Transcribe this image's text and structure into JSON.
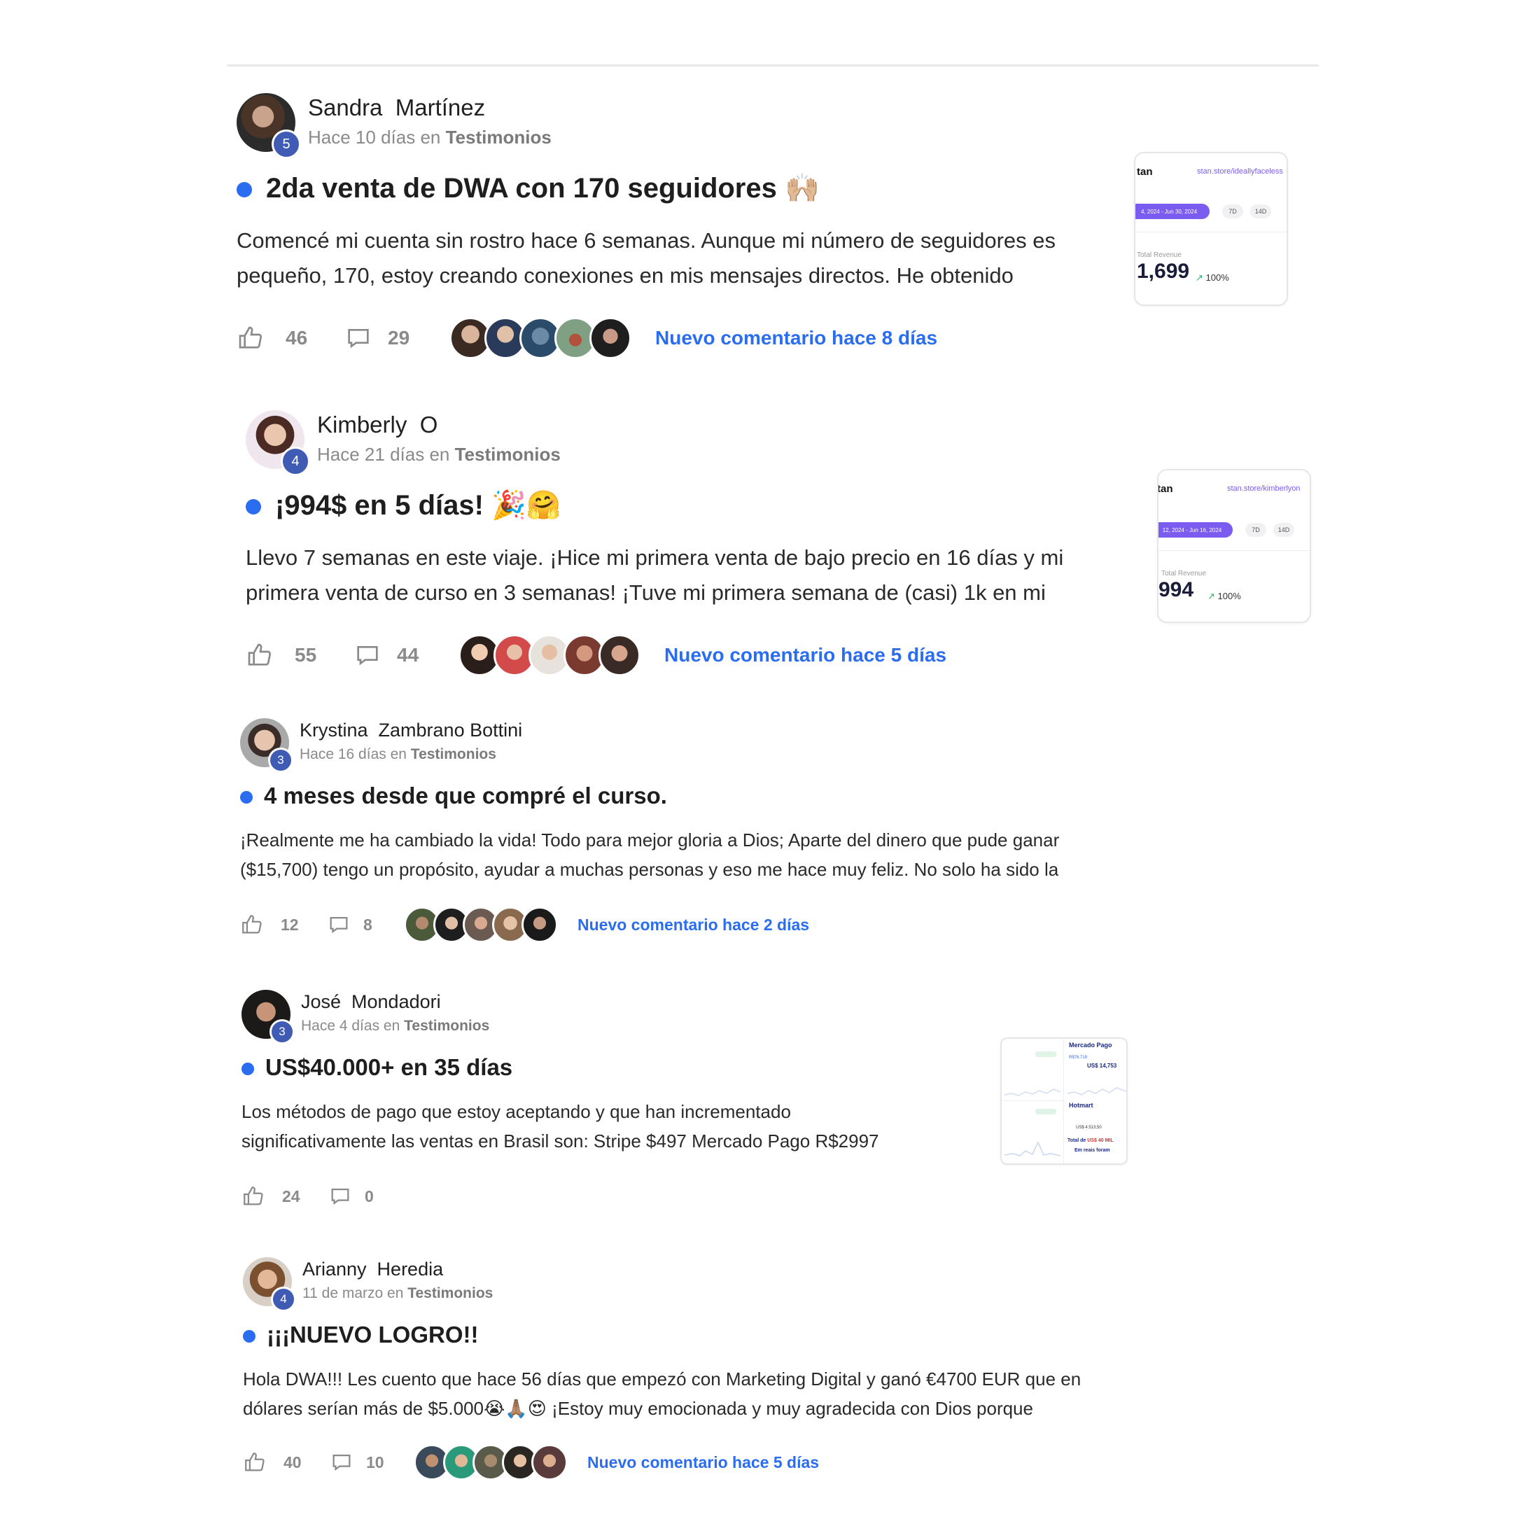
{
  "colors": {
    "accent": "#2a6df0",
    "level_badge": "#3f5bb4",
    "muted": "#8a8a8a"
  },
  "posts": [
    {
      "author": "Sandra  Martínez",
      "level": "5",
      "time": "Hace 10 días",
      "in_label": "en",
      "category": "Testimonios",
      "title": "2da venta de DWA con 170 seguidores 🙌🏼",
      "body_line1": "Comencé mi cuenta sin rostro hace 6 semanas. Aunque mi número de seguidores es",
      "body_line2": "pequeño, 170, estoy creando conexiones en mis mensajes directos. He obtenido",
      "likes": "46",
      "comments": "29",
      "new_comment": "Nuevo comentario hace 8 días",
      "thumbnail": {
        "brand": "tan",
        "url": "stan.store/ideallyfaceless",
        "range": "4, 2024 - Jun 30, 2024",
        "chip1": "7D",
        "chip2": "14D",
        "revenue_label": "Total Revenue",
        "revenue": "1,699",
        "pct": "100%"
      }
    },
    {
      "author": "Kimberly  O",
      "level": "4",
      "time": "Hace 21 días",
      "in_label": "en",
      "category": "Testimonios",
      "title": "¡994$ en 5 días! 🎉🤗",
      "body_line1": "Llevo 7 semanas en este viaje. ¡Hice mi primera venta de bajo precio en 16 días y mi",
      "body_line2": "primera venta de curso en 3 semanas! ¡Tuve mi primera semana de (casi) 1k en mi",
      "likes": "55",
      "comments": "44",
      "new_comment": "Nuevo comentario hace 5 días",
      "thumbnail": {
        "brand": "tan",
        "url": "stan.store/kimberlyon",
        "range": "12, 2024 - Jun 16, 2024",
        "chip1": "7D",
        "chip2": "14D",
        "revenue_label": "Total Revenue",
        "revenue": "994",
        "pct": "100%"
      }
    },
    {
      "author": "Krystina  Zambrano Bottini",
      "level": "3",
      "time": "Hace 16 días",
      "in_label": "en",
      "category": "Testimonios",
      "title": "4 meses desde que compré el curso.",
      "body_line1": "¡Realmente me ha cambiado la vida! Todo para mejor gloria a Dios; Aparte del dinero que pude ganar",
      "body_line2": "($15,700) tengo un propósito, ayudar a muchas personas y eso me hace muy feliz. No solo ha sido la",
      "likes": "12",
      "comments": "8",
      "new_comment": "Nuevo comentario hace 2 días"
    },
    {
      "author": "José  Mondadori",
      "level": "3",
      "time": "Hace 4 días",
      "in_label": "en",
      "category": "Testimonios",
      "title": "US$40.000+ en 35 días",
      "body_line1": "Los métodos de pago que estoy aceptando y que han incrementado",
      "body_line2": "significativamente las ventas en Brasil son: Stripe $497 Mercado Pago R$2997",
      "likes": "24",
      "comments": "0",
      "thumbnail2": {
        "mp_label": "Mercado Pago",
        "mp_small": "R$76.719",
        "mp_value": "US$ 14,753",
        "hotmart_label": "Hotmart",
        "hotmart_small": "US$ 4.513,50",
        "total_prefix": "Total de",
        "total_value": "US$ 40 MIL",
        "reais": "Em reais foram"
      }
    },
    {
      "author": "Arianny  Heredia",
      "level": "4",
      "time": "11 de marzo",
      "in_label": "en",
      "category": "Testimonios",
      "title": "¡¡¡NUEVO LOGRO!!",
      "body_line1": "Hola DWA!!! Les cuento que hace 56 días que empezó con Marketing Digital y ganó €4700 EUR que en",
      "body_line2": "dólares serían más de $5.000😭🙏🏽😍 ¡Estoy muy emocionada y muy agradecida con Dios porque",
      "likes": "40",
      "comments": "10",
      "new_comment": "Nuevo comentario hace 5 días"
    }
  ]
}
